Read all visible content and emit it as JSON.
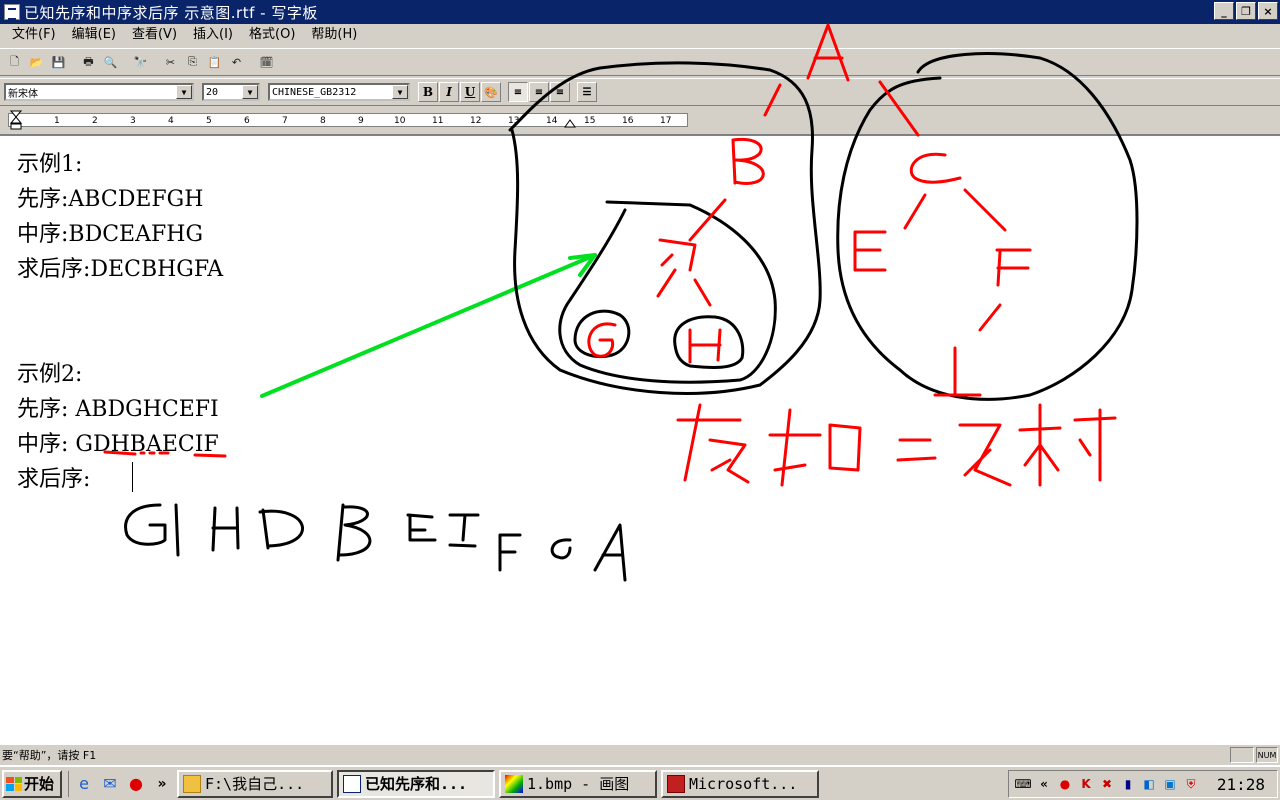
{
  "window": {
    "title": "已知先序和中序求后序 示意图.rtf - 写字板",
    "min": "_",
    "max": "❐",
    "close": "×"
  },
  "menu": [
    "文件(F)",
    "编辑(E)",
    "查看(V)",
    "插入(I)",
    "格式(O)",
    "帮助(H)"
  ],
  "format": {
    "font": "新宋体",
    "size": "20",
    "script": "CHINESE_GB2312",
    "bold": "B",
    "italic": "I",
    "underline": "U"
  },
  "ruler": [
    "1",
    "2",
    "3",
    "4",
    "5",
    "6",
    "7",
    "8",
    "9",
    "10",
    "11",
    "12",
    "13",
    "14",
    "15",
    "16",
    "17"
  ],
  "document": {
    "lines": [
      "示例1:",
      "先序:ABCDEFGH",
      "中序:BDCEAFHG",
      "求后序:DECBHGFA",
      "示例2:",
      "先序: ABDGHCEFI",
      "中序: GDHBAECIF",
      "求后序:"
    ]
  },
  "drawing": {
    "tree_nodes": [
      "A",
      "B",
      "C",
      "D",
      "E",
      "F",
      "G",
      "H",
      "I"
    ],
    "annotation": "左右=叉树",
    "answer": "GHDBEIFCA"
  },
  "status": {
    "help": "要“帮助”，请按 F1",
    "num": "NUM"
  },
  "taskbar": {
    "start": "开始",
    "tasks": [
      "F:\\我自己...",
      "已知先序和...",
      "1.bmp - 画图",
      "Microsoft..."
    ],
    "clock": "21:28"
  },
  "colors": {
    "titlebar": "#0a246a",
    "chrome": "#d4d0c8",
    "ink_red": "#ff0000",
    "ink_black": "#000000",
    "ink_green": "#00e020"
  }
}
